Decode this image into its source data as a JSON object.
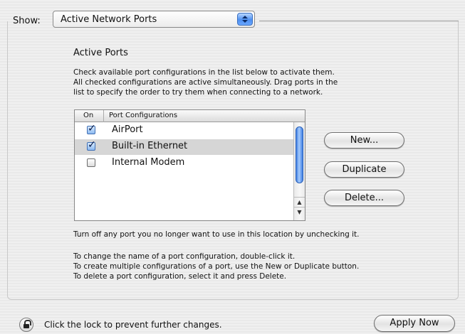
{
  "show": {
    "label": "Show:",
    "selected": "Active Network Ports"
  },
  "section": {
    "title": "Active Ports",
    "intro_lines": [
      "Check available port configurations in the list below to activate them.",
      "All checked configurations are active simultaneously. Drag ports in the",
      "list to specify the order to try them when connecting to a network."
    ]
  },
  "list": {
    "headers": {
      "on": "On",
      "config": "Port Configurations"
    },
    "rows": [
      {
        "label": "AirPort",
        "checked": true,
        "selected": false
      },
      {
        "label": "Built-in Ethernet",
        "checked": true,
        "selected": true
      },
      {
        "label": "Internal Modem",
        "checked": false,
        "selected": false
      }
    ]
  },
  "buttons": {
    "new": "New...",
    "duplicate": "Duplicate",
    "delete": "Delete..."
  },
  "turn_off_text": "Turn off any port you no longer want to use in this location by unchecking it.",
  "tips": [
    "To change the name of a port configuration, double-click it.",
    "To create multiple configurations of a port, use the New or Duplicate button.",
    "To delete a port configuration, select it and press Delete."
  ],
  "footer": {
    "lock_text": "Click the lock to prevent further changes.",
    "apply_label": "Apply Now"
  },
  "colors": {
    "selection": "#d6d6d6",
    "aqua_blue": "#4d8ff0"
  },
  "icons": {
    "popup": "up-down-arrows-icon",
    "lock": "lock-icon",
    "checkbox": "checkmark-icon"
  }
}
